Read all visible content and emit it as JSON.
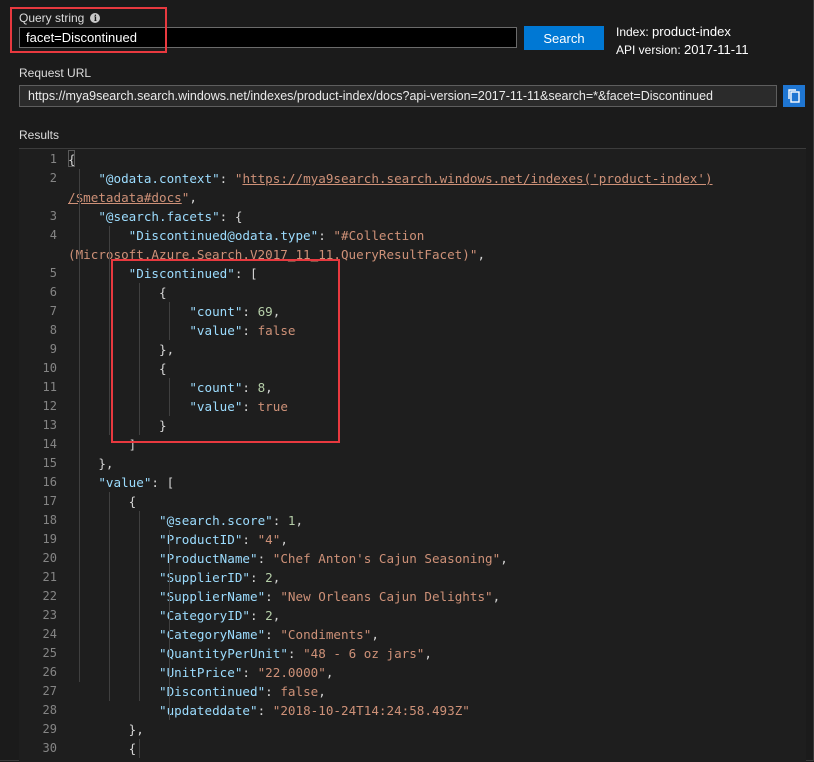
{
  "query": {
    "label": "Query string",
    "value": "facet=Discontinued"
  },
  "search_button": {
    "label": "Search"
  },
  "index_info": {
    "index_label": "Index:",
    "index_name": "product-index",
    "api_label": "API version:",
    "api_version": "2017-11-11"
  },
  "request_url": {
    "label": "Request URL",
    "value": "https://mya9search.search.windows.net/indexes/product-index/docs?api-version=2017-11-11&search=*&facet=Discontinued"
  },
  "results": {
    "label": "Results",
    "line_numbers": [
      "1",
      "2",
      "",
      "3",
      "4",
      "",
      "5",
      "6",
      "7",
      "8",
      "9",
      "10",
      "11",
      "12",
      "13",
      "14",
      "15",
      "16",
      "17",
      "18",
      "19",
      "20",
      "21",
      "22",
      "23",
      "24",
      "25",
      "26",
      "27",
      "28",
      "29",
      "30"
    ],
    "lines": [
      [
        {
          "t": "{",
          "c": "p"
        }
      ],
      [
        {
          "t": "    ",
          "c": "p"
        },
        {
          "t": "\"@odata.context\"",
          "c": "key"
        },
        {
          "t": ": ",
          "c": "p"
        },
        {
          "t": "\"",
          "c": "str"
        },
        {
          "t": "https://mya9search.search.windows.net/indexes('product-index')",
          "c": "url-link"
        }
      ],
      [
        {
          "t": "/$metadata#docs",
          "c": "url-link"
        },
        {
          "t": "\"",
          "c": "str"
        },
        {
          "t": ",",
          "c": "p"
        }
      ],
      [
        {
          "t": "    ",
          "c": "p"
        },
        {
          "t": "\"@search.facets\"",
          "c": "key"
        },
        {
          "t": ": {",
          "c": "p"
        }
      ],
      [
        {
          "t": "        ",
          "c": "p"
        },
        {
          "t": "\"Discontinued@odata.type\"",
          "c": "key"
        },
        {
          "t": ": ",
          "c": "p"
        },
        {
          "t": "\"#Collection",
          "c": "str"
        }
      ],
      [
        {
          "t": "(Microsoft.Azure.Search.V2017_11_11.QueryResultFacet)\"",
          "c": "str"
        },
        {
          "t": ",",
          "c": "p"
        }
      ],
      [
        {
          "t": "        ",
          "c": "p"
        },
        {
          "t": "\"Discontinued\"",
          "c": "key"
        },
        {
          "t": ": [",
          "c": "p"
        }
      ],
      [
        {
          "t": "            {",
          "c": "p"
        }
      ],
      [
        {
          "t": "                ",
          "c": "p"
        },
        {
          "t": "\"count\"",
          "c": "key"
        },
        {
          "t": ": ",
          "c": "p"
        },
        {
          "t": "69",
          "c": "num"
        },
        {
          "t": ",",
          "c": "p"
        }
      ],
      [
        {
          "t": "                ",
          "c": "p"
        },
        {
          "t": "\"value\"",
          "c": "key"
        },
        {
          "t": ": ",
          "c": "p"
        },
        {
          "t": "false",
          "c": "str"
        }
      ],
      [
        {
          "t": "            },",
          "c": "p"
        }
      ],
      [
        {
          "t": "            {",
          "c": "p"
        }
      ],
      [
        {
          "t": "                ",
          "c": "p"
        },
        {
          "t": "\"count\"",
          "c": "key"
        },
        {
          "t": ": ",
          "c": "p"
        },
        {
          "t": "8",
          "c": "num"
        },
        {
          "t": ",",
          "c": "p"
        }
      ],
      [
        {
          "t": "                ",
          "c": "p"
        },
        {
          "t": "\"value\"",
          "c": "key"
        },
        {
          "t": ": ",
          "c": "p"
        },
        {
          "t": "true",
          "c": "str"
        }
      ],
      [
        {
          "t": "            }",
          "c": "p"
        }
      ],
      [
        {
          "t": "        ]",
          "c": "p"
        }
      ],
      [
        {
          "t": "    },",
          "c": "p"
        }
      ],
      [
        {
          "t": "    ",
          "c": "p"
        },
        {
          "t": "\"value\"",
          "c": "key"
        },
        {
          "t": ": [",
          "c": "p"
        }
      ],
      [
        {
          "t": "        {",
          "c": "p"
        }
      ],
      [
        {
          "t": "            ",
          "c": "p"
        },
        {
          "t": "\"@search.score\"",
          "c": "key"
        },
        {
          "t": ": ",
          "c": "p"
        },
        {
          "t": "1",
          "c": "num"
        },
        {
          "t": ",",
          "c": "p"
        }
      ],
      [
        {
          "t": "            ",
          "c": "p"
        },
        {
          "t": "\"ProductID\"",
          "c": "key"
        },
        {
          "t": ": ",
          "c": "p"
        },
        {
          "t": "\"4\"",
          "c": "str"
        },
        {
          "t": ",",
          "c": "p"
        }
      ],
      [
        {
          "t": "            ",
          "c": "p"
        },
        {
          "t": "\"ProductName\"",
          "c": "key"
        },
        {
          "t": ": ",
          "c": "p"
        },
        {
          "t": "\"Chef Anton's Cajun Seasoning\"",
          "c": "str"
        },
        {
          "t": ",",
          "c": "p"
        }
      ],
      [
        {
          "t": "            ",
          "c": "p"
        },
        {
          "t": "\"SupplierID\"",
          "c": "key"
        },
        {
          "t": ": ",
          "c": "p"
        },
        {
          "t": "2",
          "c": "num"
        },
        {
          "t": ",",
          "c": "p"
        }
      ],
      [
        {
          "t": "            ",
          "c": "p"
        },
        {
          "t": "\"SupplierName\"",
          "c": "key"
        },
        {
          "t": ": ",
          "c": "p"
        },
        {
          "t": "\"New Orleans Cajun Delights\"",
          "c": "str"
        },
        {
          "t": ",",
          "c": "p"
        }
      ],
      [
        {
          "t": "            ",
          "c": "p"
        },
        {
          "t": "\"CategoryID\"",
          "c": "key"
        },
        {
          "t": ": ",
          "c": "p"
        },
        {
          "t": "2",
          "c": "num"
        },
        {
          "t": ",",
          "c": "p"
        }
      ],
      [
        {
          "t": "            ",
          "c": "p"
        },
        {
          "t": "\"CategoryName\"",
          "c": "key"
        },
        {
          "t": ": ",
          "c": "p"
        },
        {
          "t": "\"Condiments\"",
          "c": "str"
        },
        {
          "t": ",",
          "c": "p"
        }
      ],
      [
        {
          "t": "            ",
          "c": "p"
        },
        {
          "t": "\"QuantityPerUnit\"",
          "c": "key"
        },
        {
          "t": ": ",
          "c": "p"
        },
        {
          "t": "\"48 - 6 oz jars\"",
          "c": "str"
        },
        {
          "t": ",",
          "c": "p"
        }
      ],
      [
        {
          "t": "            ",
          "c": "p"
        },
        {
          "t": "\"UnitPrice\"",
          "c": "key"
        },
        {
          "t": ": ",
          "c": "p"
        },
        {
          "t": "\"22.0000\"",
          "c": "str"
        },
        {
          "t": ",",
          "c": "p"
        }
      ],
      [
        {
          "t": "            ",
          "c": "p"
        },
        {
          "t": "\"Discontinued\"",
          "c": "key"
        },
        {
          "t": ": ",
          "c": "p"
        },
        {
          "t": "false",
          "c": "str"
        },
        {
          "t": ",",
          "c": "p"
        }
      ],
      [
        {
          "t": "            ",
          "c": "p"
        },
        {
          "t": "\"updateddate\"",
          "c": "key"
        },
        {
          "t": ": ",
          "c": "p"
        },
        {
          "t": "\"2018-10-24T14:24:58.493Z\"",
          "c": "str"
        }
      ],
      [
        {
          "t": "        },",
          "c": "p"
        }
      ],
      [
        {
          "t": "        {",
          "c": "p"
        }
      ]
    ]
  }
}
